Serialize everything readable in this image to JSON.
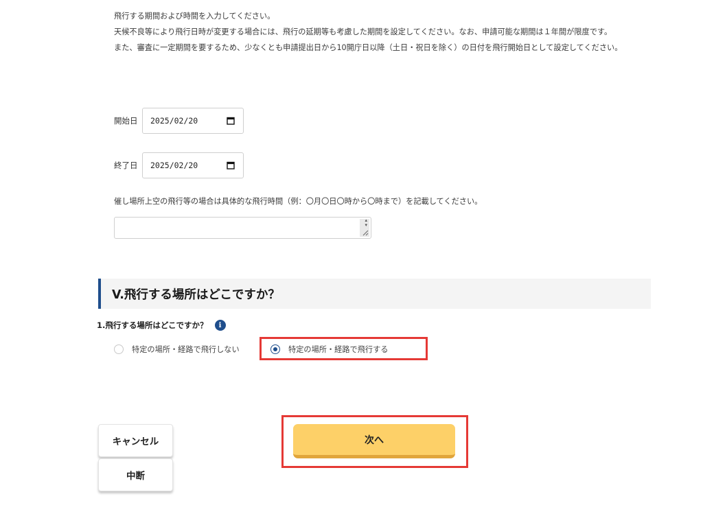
{
  "instructions": [
    "飛行する期間および時間を入力してください。",
    "天候不良等により飛行日時が変更する場合には、飛行の延期等も考慮した期間を設定してください。なお、申請可能な期間は１年間が限度です。",
    "また、審査に一定期間を要するため、少なくとも申請提出日から10開庁日以降（土日・祝日を除く）の日付を飛行開始日として設定してください。"
  ],
  "start_date": {
    "label": "開始日",
    "value": "2025/02/20"
  },
  "end_date": {
    "label": "終了日",
    "value": "2025/02/20"
  },
  "event_note": "催し場所上空の飛行等の場合は具体的な飛行時間（例：〇月〇日〇時から〇時まで）を記載してください。",
  "event_time_value": "",
  "section": {
    "title": "V.飛行する場所はどこですか？"
  },
  "question": {
    "text": "1.飛行する場所はどこですか？",
    "info_icon": "info-icon"
  },
  "options": [
    {
      "label": "特定の場所・経路で飛行しない",
      "checked": false
    },
    {
      "label": "特定の場所・経路で飛行する",
      "checked": true
    }
  ],
  "buttons": {
    "cancel": "キャンセル",
    "suspend": "中断",
    "next": "次へ"
  },
  "colors": {
    "accent": "#1f4e8c",
    "next_button": "#fdd068",
    "highlight": "#e53935"
  }
}
